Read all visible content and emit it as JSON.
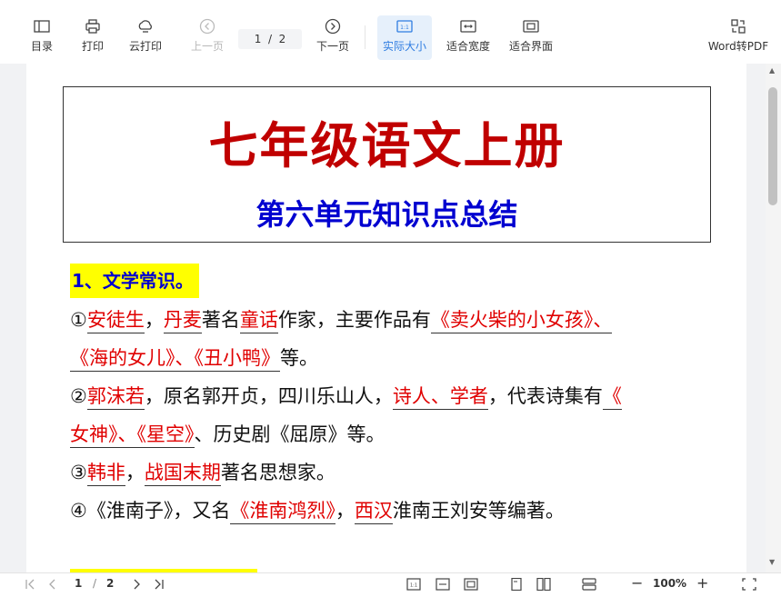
{
  "toolbar": {
    "toc": "目录",
    "print": "打印",
    "cloud_print": "云打印",
    "prev_page": "上一页",
    "page_current": "1",
    "page_total": "2",
    "next_page": "下一页",
    "actual_size": "实际大小",
    "fit_width": "适合宽度",
    "fit_window": "适合界面",
    "word_to_pdf": "Word转PDF"
  },
  "document": {
    "title": "七年级语文上册",
    "subtitle": "第六单元知识点总结",
    "section1": "1、文学常识。",
    "lines": [
      {
        "p1": "①",
        "p2": "安徒生",
        "p3": "，",
        "p4": "丹麦",
        "p5": "著名",
        "p6": "童话",
        "p7": "作家，主要作品有",
        "p8": "《卖火柴的小女孩》、"
      },
      {
        "p1": "《海的女儿》、《丑小鸭》",
        "p2": "等。"
      },
      {
        "p1": "②",
        "p2": "郭沫若",
        "p3": "，原名郭开贞，四川乐山人，",
        "p4": "诗人、学者",
        "p5": "，代表诗集有",
        "p6": "《"
      },
      {
        "p1": "女神》、《星空》",
        "p2": "、历史剧《屈原》等。"
      },
      {
        "p1": "③",
        "p2": "韩非",
        "p3": "，",
        "p4": "战国末期",
        "p5": "著名思想家。"
      },
      {
        "p1": "④《淮南子》，又名",
        "p2": "《淮南鸿烈》",
        "p3": "，",
        "p4": "西汉",
        "p5": "淮南王刘安等编著。"
      }
    ]
  },
  "footer": {
    "page_current": "1",
    "page_sep": "/",
    "page_total": "2",
    "zoom": "100%"
  },
  "colors": {
    "title_red": "#c00000",
    "subtitle_blue": "#0000d0",
    "highlight": "#ffff00",
    "text_red": "#e00000",
    "active_blue": "#2f7de1"
  }
}
